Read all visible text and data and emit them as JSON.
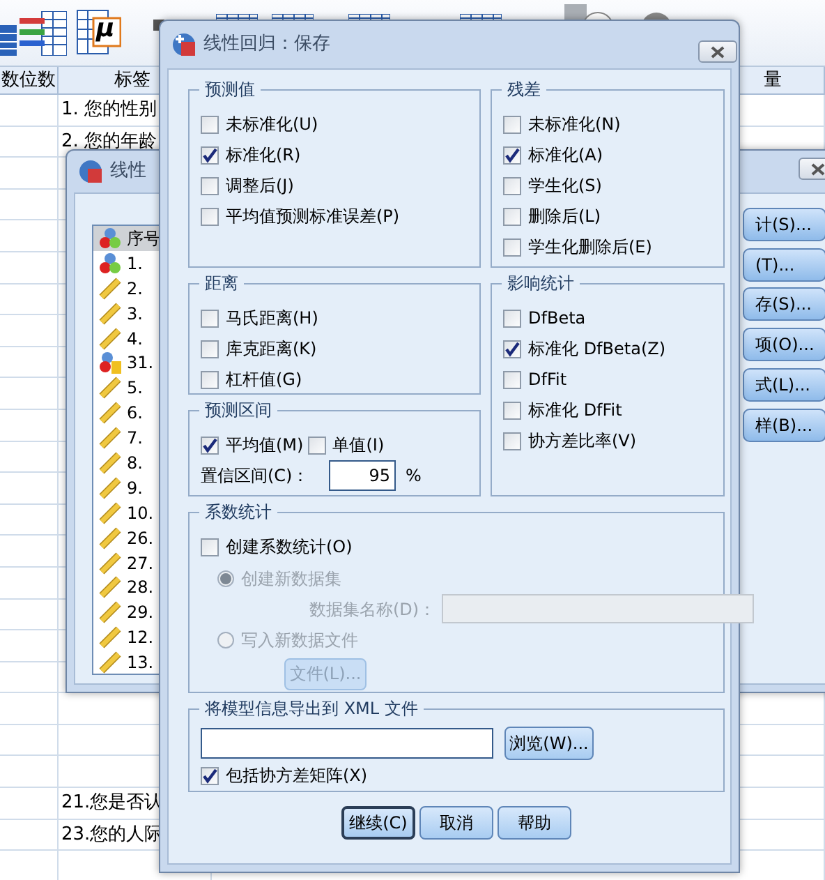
{
  "toolbar": {
    "mu_label": "μ"
  },
  "data_view": {
    "columns": [
      "数位数",
      "标签",
      "量"
    ],
    "top_rows": [
      "1. 您的性别",
      "2. 您的年龄"
    ],
    "bottom_rows": [
      "21.您是否认",
      "23.您的人际"
    ]
  },
  "back_dialog": {
    "title": "线性",
    "variables": [
      {
        "label": "序号",
        "kind": "nominal",
        "selected": true
      },
      {
        "label": "1.",
        "kind": "nominal",
        "selected": false
      },
      {
        "label": "2.",
        "kind": "scale",
        "selected": false
      },
      {
        "label": "3.",
        "kind": "scale",
        "selected": false
      },
      {
        "label": "4.",
        "kind": "scale",
        "selected": false
      },
      {
        "label": "31.",
        "kind": "string",
        "selected": false
      },
      {
        "label": "5.",
        "kind": "scale",
        "selected": false
      },
      {
        "label": "6.",
        "kind": "scale",
        "selected": false
      },
      {
        "label": "7.",
        "kind": "scale",
        "selected": false
      },
      {
        "label": "8.",
        "kind": "scale",
        "selected": false
      },
      {
        "label": "9.",
        "kind": "scale",
        "selected": false
      },
      {
        "label": "10.",
        "kind": "scale",
        "selected": false
      },
      {
        "label": "26.",
        "kind": "scale",
        "selected": false
      },
      {
        "label": "27.",
        "kind": "scale",
        "selected": false
      },
      {
        "label": "28.",
        "kind": "scale",
        "selected": false
      },
      {
        "label": "29.",
        "kind": "scale",
        "selected": false
      },
      {
        "label": "12.",
        "kind": "scale",
        "selected": false
      },
      {
        "label": "13.",
        "kind": "scale",
        "selected": false
      }
    ],
    "buttons": [
      "计(S)...",
      "(T)...",
      "存(S)...",
      "项(O)...",
      "式(L)...",
      "样(B)..."
    ]
  },
  "dialog": {
    "title": "线性回归：保存",
    "predicted_values": {
      "legend": "预测值",
      "options": [
        {
          "label": "未标准化(U)",
          "checked": false
        },
        {
          "label": "标准化(R)",
          "checked": true
        },
        {
          "label": "调整后(J)",
          "checked": false
        },
        {
          "label": "平均值预测标准误差(P)",
          "checked": false
        }
      ]
    },
    "residuals": {
      "legend": "残差",
      "options": [
        {
          "label": "未标准化(N)",
          "checked": false
        },
        {
          "label": "标准化(A)",
          "checked": true
        },
        {
          "label": "学生化(S)",
          "checked": false
        },
        {
          "label": "删除后(L)",
          "checked": false
        },
        {
          "label": "学生化删除后(E)",
          "checked": false
        }
      ]
    },
    "distances": {
      "legend": "距离",
      "options": [
        {
          "label": "马氏距离(H)",
          "checked": false
        },
        {
          "label": "库克距离(K)",
          "checked": false
        },
        {
          "label": "杠杆值(G)",
          "checked": false
        }
      ]
    },
    "influence": {
      "legend": "影响统计",
      "options": [
        {
          "label": "DfBeta",
          "checked": false
        },
        {
          "label": "标准化 DfBeta(Z)",
          "checked": true
        },
        {
          "label": "DfFit",
          "checked": false
        },
        {
          "label": "标准化 DfFit",
          "checked": false
        },
        {
          "label": "协方差比率(V)",
          "checked": false
        }
      ]
    },
    "prediction_intervals": {
      "legend": "预测区间",
      "options": [
        {
          "label": "平均值(M)",
          "checked": true
        },
        {
          "label": "单值(I)",
          "checked": false
        }
      ],
      "confidence": {
        "label": "置信区间(C)：",
        "value": "95",
        "unit": "%"
      }
    },
    "coefficients": {
      "legend": "系数统计",
      "create": {
        "label": "创建系数统计(O)",
        "checked": false
      },
      "choices": [
        {
          "label": "创建新数据集",
          "selected": true,
          "disabled": true
        },
        {
          "label": "写入新数据文件",
          "selected": false,
          "disabled": true
        }
      ],
      "dataset_name": {
        "label": "数据集名称(D)：",
        "disabled": true
      },
      "file_button": {
        "label": "文件(L)...",
        "disabled": true
      }
    },
    "xml_export": {
      "legend": "将模型信息导出到 XML 文件",
      "browse": "浏览(W)...",
      "include_covariance": {
        "label": "包括协方差矩阵(X)",
        "checked": true
      }
    },
    "buttons": [
      {
        "label": "继续(C)",
        "focused": true
      },
      {
        "label": "取消",
        "focused": false
      },
      {
        "label": "帮助",
        "focused": false
      }
    ]
  }
}
